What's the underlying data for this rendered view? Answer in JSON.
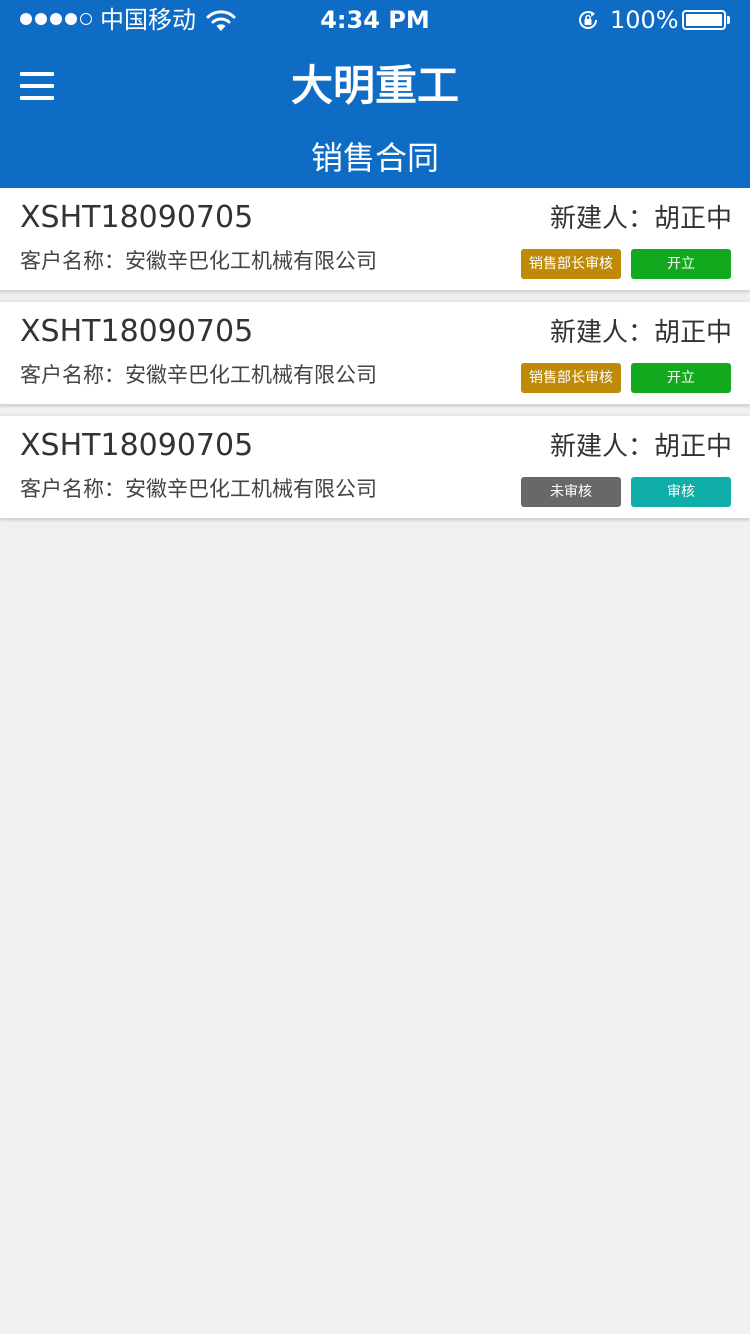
{
  "status_bar": {
    "carrier": "中国移动",
    "time": "4:34 PM",
    "battery": "100%"
  },
  "header": {
    "app_title": "大明重工",
    "page_subtitle": "销售合同"
  },
  "colors": {
    "header_bg": "#0f6cc4",
    "tag_review_pending_head": "#c08a09",
    "tag_open": "#13a91e",
    "tag_unreviewed": "#686868",
    "tag_review": "#10aea8"
  },
  "contracts": [
    {
      "contract_no": "XSHT18090705",
      "creator": "新建人：胡正中",
      "customer": "客户名称：安徽辛巴化工机械有限公司",
      "status_tag": "销售部长审核",
      "status_color": "#c08a09",
      "action_tag": "开立",
      "action_color": "#13a91e"
    },
    {
      "contract_no": "XSHT18090705",
      "creator": "新建人：胡正中",
      "customer": "客户名称：安徽辛巴化工机械有限公司",
      "status_tag": "销售部长审核",
      "status_color": "#c08a09",
      "action_tag": "开立",
      "action_color": "#13a91e"
    },
    {
      "contract_no": "XSHT18090705",
      "creator": "新建人：胡正中",
      "customer": "客户名称：安徽辛巴化工机械有限公司",
      "status_tag": "未审核",
      "status_color": "#686868",
      "action_tag": "审核",
      "action_color": "#10aea8"
    }
  ]
}
